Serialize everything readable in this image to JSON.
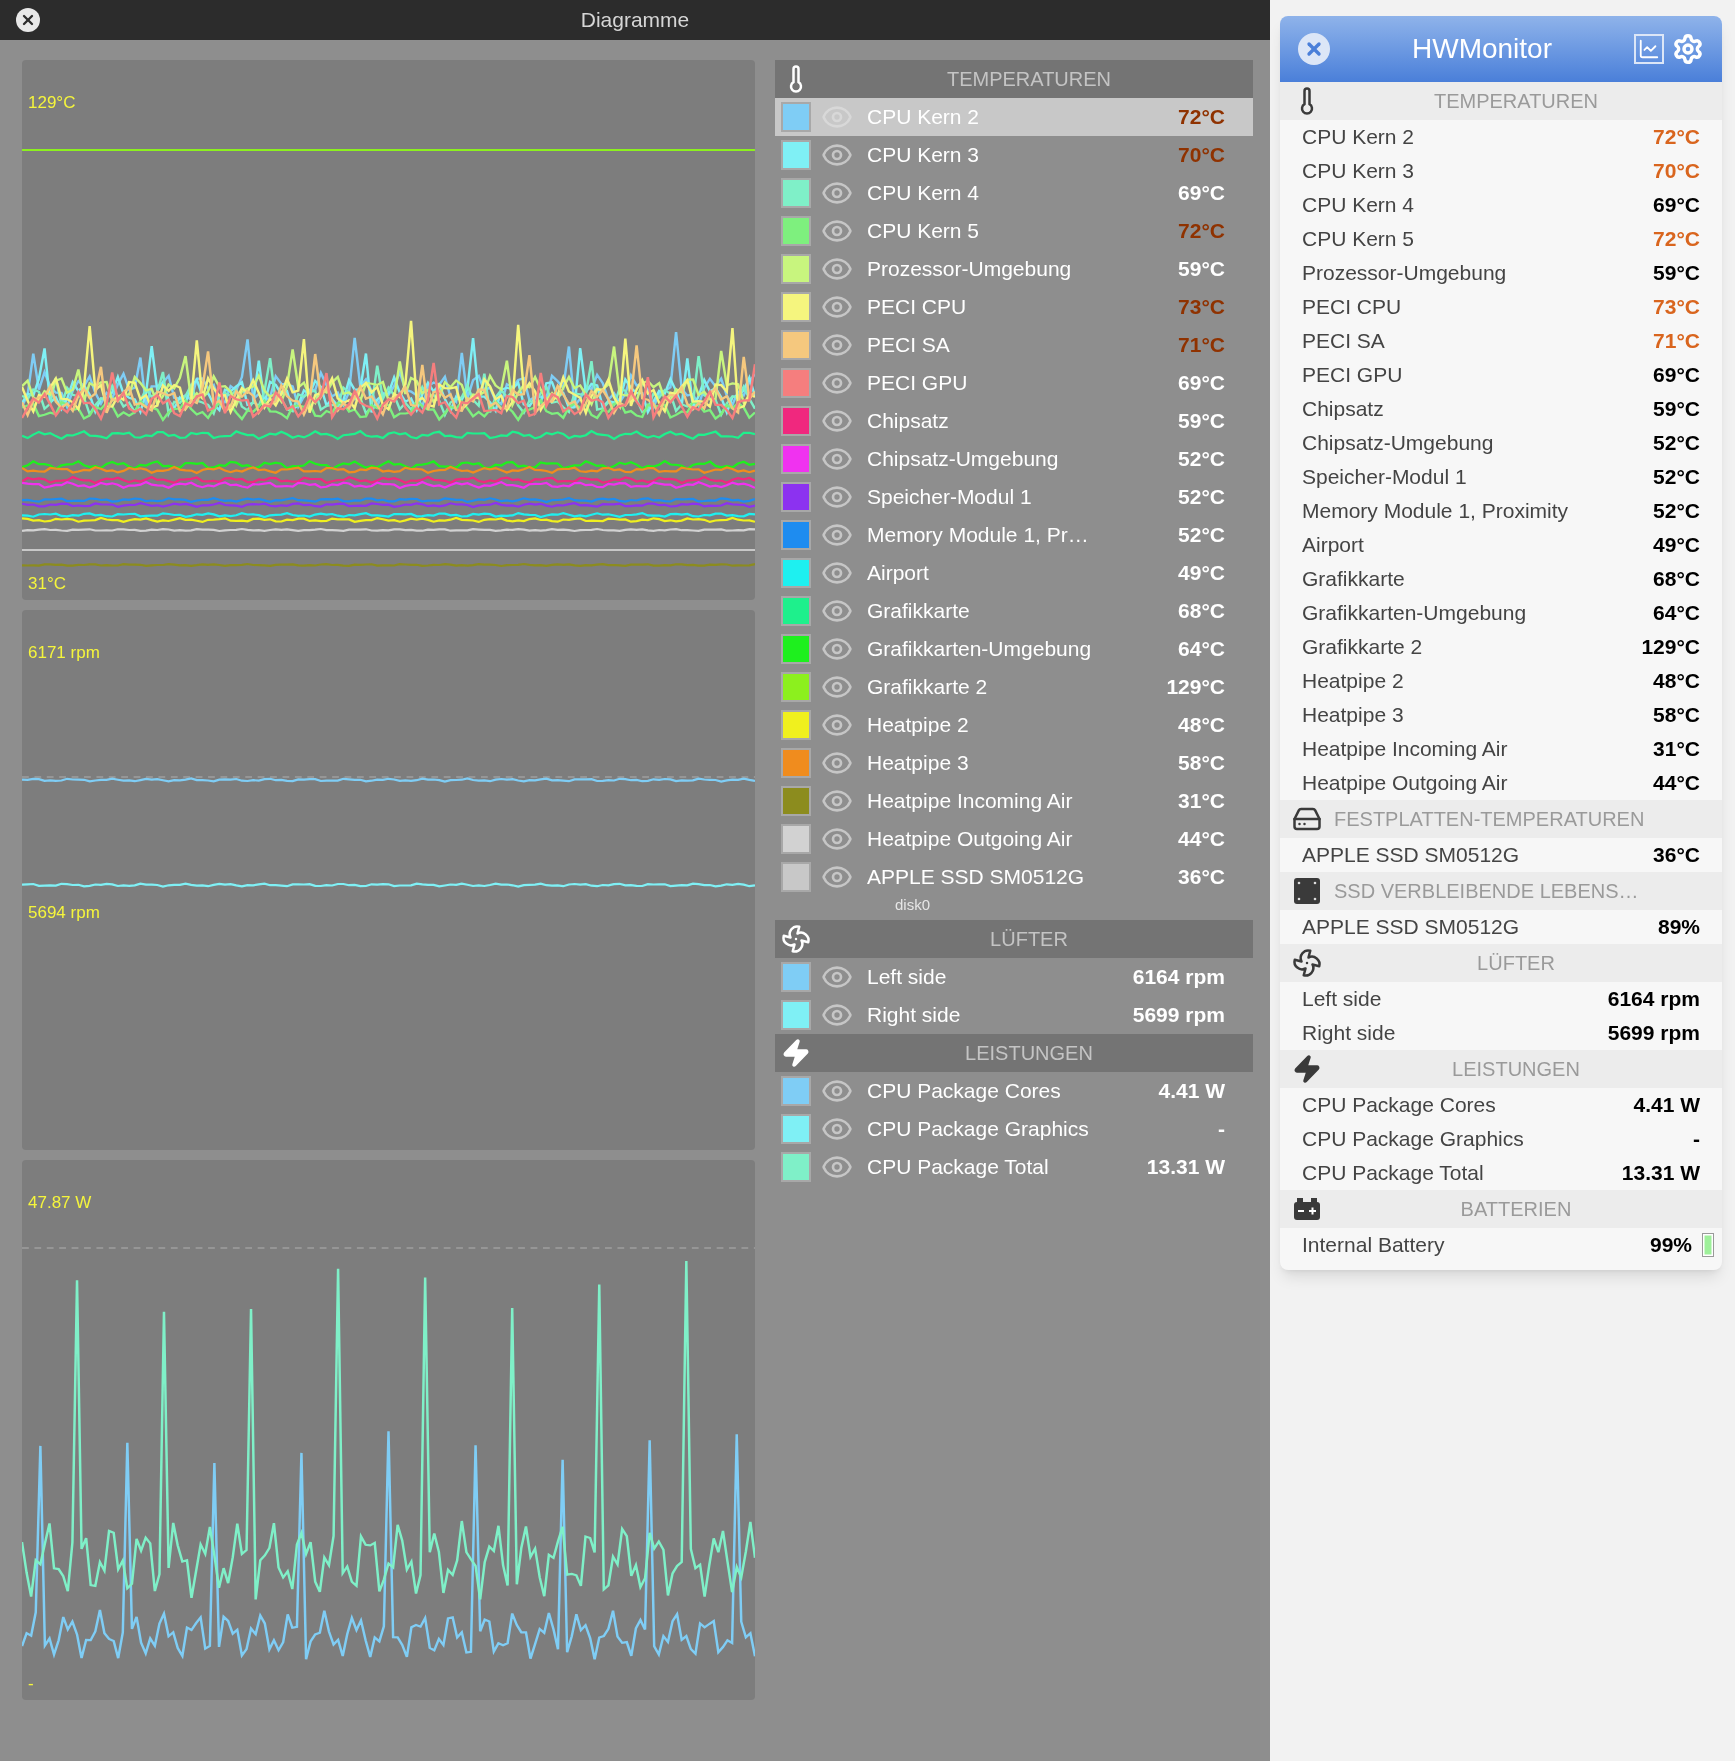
{
  "diagram_window": {
    "title": "Diagramme",
    "charts": [
      {
        "kind": "temperature",
        "top_label": "129°C",
        "bottom_label": "31°C"
      },
      {
        "kind": "fan",
        "top_label": "6171 rpm",
        "bottom_label": "5694 rpm"
      },
      {
        "kind": "power",
        "top_label": "47.87 W",
        "bottom_label": "-"
      }
    ],
    "legend": [
      {
        "kind": "temperature",
        "title": "TEMPERATUREN",
        "items": [
          {
            "name": "CPU Kern 2",
            "value": "72°C",
            "color": "#7fcdf5",
            "hot": true,
            "selected": true
          },
          {
            "name": "CPU Kern 3",
            "value": "70°C",
            "color": "#7ff0f5",
            "hot": true,
            "selected": false
          },
          {
            "name": "CPU Kern 4",
            "value": "69°C",
            "color": "#7ff0c8",
            "hot": false,
            "selected": false
          },
          {
            "name": "CPU Kern 5",
            "value": "72°C",
            "color": "#7ef07e",
            "hot": true,
            "selected": false
          },
          {
            "name": "Prozessor-Umgebung",
            "value": "59°C",
            "color": "#c8f57e",
            "hot": false,
            "selected": false
          },
          {
            "name": "PECI CPU",
            "value": "73°C",
            "color": "#f5f57e",
            "hot": true,
            "selected": false
          },
          {
            "name": "PECI SA",
            "value": "71°C",
            "color": "#f5c87e",
            "hot": true,
            "selected": false
          },
          {
            "name": "PECI GPU",
            "value": "69°C",
            "color": "#f57e7e",
            "hot": false,
            "selected": false
          },
          {
            "name": "Chipsatz",
            "value": "59°C",
            "color": "#f0287e",
            "hot": false,
            "selected": false
          },
          {
            "name": "Chipsatz-Umgebung",
            "value": "52°C",
            "color": "#f032f0",
            "hot": false,
            "selected": false
          },
          {
            "name": "Speicher-Modul 1",
            "value": "52°C",
            "color": "#8c32f0",
            "hot": false,
            "selected": false
          },
          {
            "name": "Memory Module 1, Pr…",
            "value": "52°C",
            "color": "#1e8cf0",
            "hot": false,
            "selected": false
          },
          {
            "name": "Airport",
            "value": "49°C",
            "color": "#1ef0f0",
            "hot": false,
            "selected": false
          },
          {
            "name": "Grafikkarte",
            "value": "68°C",
            "color": "#1ef08c",
            "hot": false,
            "selected": false
          },
          {
            "name": "Grafikkarten-Umgebung",
            "value": "64°C",
            "color": "#1ef01e",
            "hot": false,
            "selected": false
          },
          {
            "name": "Grafikkarte 2",
            "value": "129°C",
            "color": "#8cf01e",
            "hot": false,
            "selected": false
          },
          {
            "name": "Heatpipe 2",
            "value": "48°C",
            "color": "#f0f01e",
            "hot": false,
            "selected": false
          },
          {
            "name": "Heatpipe 3",
            "value": "58°C",
            "color": "#f08c1e",
            "hot": false,
            "selected": false
          },
          {
            "name": "Heatpipe Incoming Air",
            "value": "31°C",
            "color": "#8c8c1e",
            "hot": false,
            "selected": false
          },
          {
            "name": "Heatpipe Outgoing Air",
            "value": "44°C",
            "color": "#d2d2d2",
            "hot": false,
            "selected": false
          },
          {
            "name": "APPLE SSD SM0512G",
            "value": "36°C",
            "color": "#c8c8c8",
            "hot": false,
            "selected": false,
            "note": "disk0"
          }
        ]
      },
      {
        "kind": "fan",
        "title": "LÜFTER",
        "items": [
          {
            "name": "Left side",
            "value": "6164 rpm",
            "color": "#7fcdf5",
            "hot": false,
            "selected": false
          },
          {
            "name": "Right side",
            "value": "5699 rpm",
            "color": "#7ff0f5",
            "hot": false,
            "selected": false
          }
        ]
      },
      {
        "kind": "power",
        "title": "LEISTUNGEN",
        "items": [
          {
            "name": "CPU Package Cores",
            "value": "4.41 W",
            "color": "#7fcdf5",
            "hot": false,
            "selected": false
          },
          {
            "name": "CPU Package Graphics",
            "value": "-",
            "color": "#7ff0f5",
            "hot": false,
            "selected": false
          },
          {
            "name": "CPU Package Total",
            "value": "13.31 W",
            "color": "#7ff0c8",
            "hot": false,
            "selected": false
          }
        ]
      }
    ]
  },
  "hwmonitor_window": {
    "title": "HWMonitor",
    "sections": [
      {
        "kind": "temperature",
        "title": "TEMPERATUREN",
        "items": [
          {
            "name": "CPU Kern 2",
            "value": "72°C",
            "hot": true
          },
          {
            "name": "CPU Kern 3",
            "value": "70°C",
            "hot": true
          },
          {
            "name": "CPU Kern 4",
            "value": "69°C",
            "hot": false
          },
          {
            "name": "CPU Kern 5",
            "value": "72°C",
            "hot": true
          },
          {
            "name": "Prozessor-Umgebung",
            "value": "59°C",
            "hot": false
          },
          {
            "name": "PECI CPU",
            "value": "73°C",
            "hot": true
          },
          {
            "name": "PECI SA",
            "value": "71°C",
            "hot": true
          },
          {
            "name": "PECI GPU",
            "value": "69°C",
            "hot": false
          },
          {
            "name": "Chipsatz",
            "value": "59°C",
            "hot": false
          },
          {
            "name": "Chipsatz-Umgebung",
            "value": "52°C",
            "hot": false
          },
          {
            "name": "Speicher-Modul 1",
            "value": "52°C",
            "hot": false
          },
          {
            "name": "Memory Module 1, Proximity",
            "value": "52°C",
            "hot": false
          },
          {
            "name": "Airport",
            "value": "49°C",
            "hot": false
          },
          {
            "name": "Grafikkarte",
            "value": "68°C",
            "hot": false
          },
          {
            "name": "Grafikkarten-Umgebung",
            "value": "64°C",
            "hot": false
          },
          {
            "name": "Grafikkarte 2",
            "value": "129°C",
            "hot": false
          },
          {
            "name": "Heatpipe 2",
            "value": "48°C",
            "hot": false
          },
          {
            "name": "Heatpipe 3",
            "value": "58°C",
            "hot": false
          },
          {
            "name": "Heatpipe Incoming Air",
            "value": "31°C",
            "hot": false
          },
          {
            "name": "Heatpipe Outgoing Air",
            "value": "44°C",
            "hot": false
          }
        ]
      },
      {
        "kind": "disk",
        "title": "FESTPLATTEN-TEMPERATUREN",
        "items": [
          {
            "name": "APPLE SSD SM0512G",
            "value": "36°C",
            "hot": false
          }
        ]
      },
      {
        "kind": "ssd",
        "title": "SSD VERBLEIBENDE LEBENS…",
        "items": [
          {
            "name": "APPLE SSD SM0512G",
            "value": "89%",
            "hot": false
          }
        ]
      },
      {
        "kind": "fan",
        "title": "LÜFTER",
        "items": [
          {
            "name": "Left side",
            "value": "6164 rpm",
            "hot": false
          },
          {
            "name": "Right side",
            "value": "5699 rpm",
            "hot": false
          }
        ]
      },
      {
        "kind": "power",
        "title": "LEISTUNGEN",
        "items": [
          {
            "name": "CPU Package Cores",
            "value": "4.41 W",
            "hot": false
          },
          {
            "name": "CPU Package Graphics",
            "value": "-",
            "hot": false
          },
          {
            "name": "CPU Package Total",
            "value": "13.31 W",
            "hot": false
          }
        ]
      },
      {
        "kind": "battery",
        "title": "BATTERIEN",
        "items": [
          {
            "name": "Internal Battery",
            "value": "99%",
            "hot": false
          }
        ]
      }
    ]
  }
}
